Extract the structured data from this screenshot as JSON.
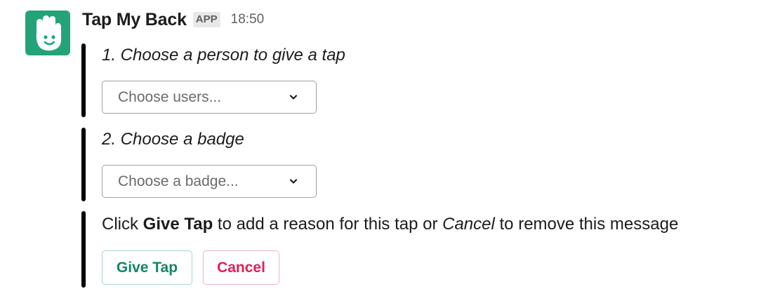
{
  "app": {
    "name": "Tap My Back",
    "badge": "APP",
    "timestamp": "18:50",
    "avatar_icon": "waving-hand-smiley-icon",
    "avatar_color": "#24a37a"
  },
  "step1": {
    "title": "1. Choose a person to give a tap",
    "select_placeholder": "Choose users..."
  },
  "step2": {
    "title": "2. Choose a badge",
    "select_placeholder": "Choose a badge..."
  },
  "step3": {
    "text_prefix": "Click ",
    "text_bold": "Give Tap",
    "text_middle": " to add a reason for this tap or ",
    "text_italic": "Cancel",
    "text_suffix": " to remove this message",
    "primary_button": "Give Tap",
    "cancel_button": "Cancel"
  },
  "colors": {
    "attachment_bar": "#000000",
    "primary": "#148567",
    "danger": "#e01e5a"
  }
}
